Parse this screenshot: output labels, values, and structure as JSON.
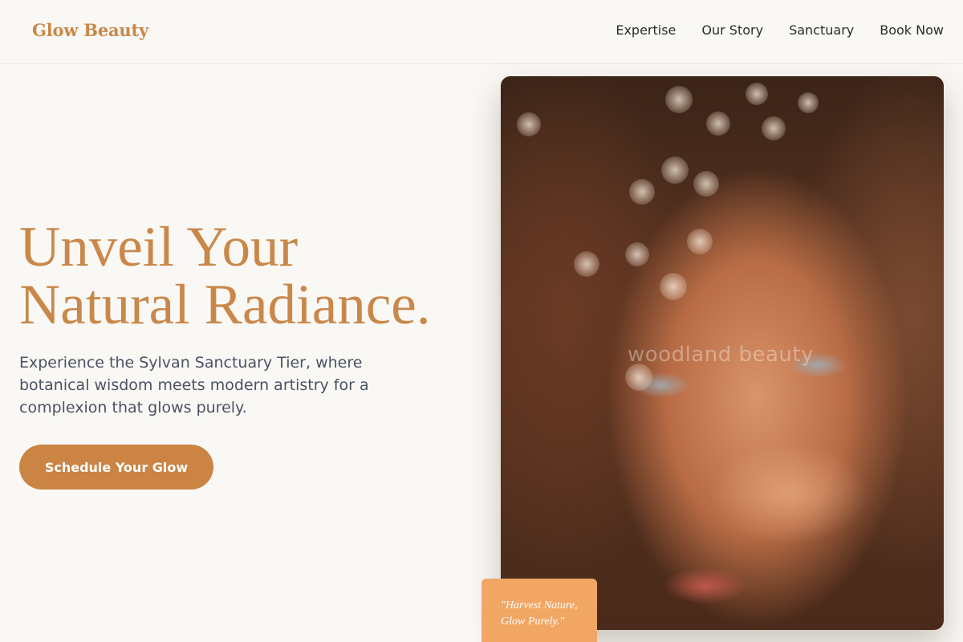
{
  "brand": {
    "name": "Glow Beauty"
  },
  "nav": [
    {
      "label": "Expertise"
    },
    {
      "label": "Our Story"
    },
    {
      "label": "Sanctuary"
    },
    {
      "label": "Book Now"
    }
  ],
  "hero": {
    "title_line1": "Unveil Your",
    "title_line2": "Natural Radiance.",
    "subtitle": "Experience the Sylvan Sanctuary Tier, where botanical wisdom meets modern artistry for a complexion that glows purely.",
    "cta_label": "Schedule Your Glow"
  },
  "image": {
    "watermark": "woodland beauty"
  },
  "quote": {
    "line1": "\"Harvest Nature,",
    "line2": "Glow Purely.\""
  },
  "colors": {
    "accent": "#c98849",
    "cta": "#cb8443",
    "quote_card": "#f2a664",
    "background": "#faf8f5",
    "body_text": "#4a5263"
  }
}
